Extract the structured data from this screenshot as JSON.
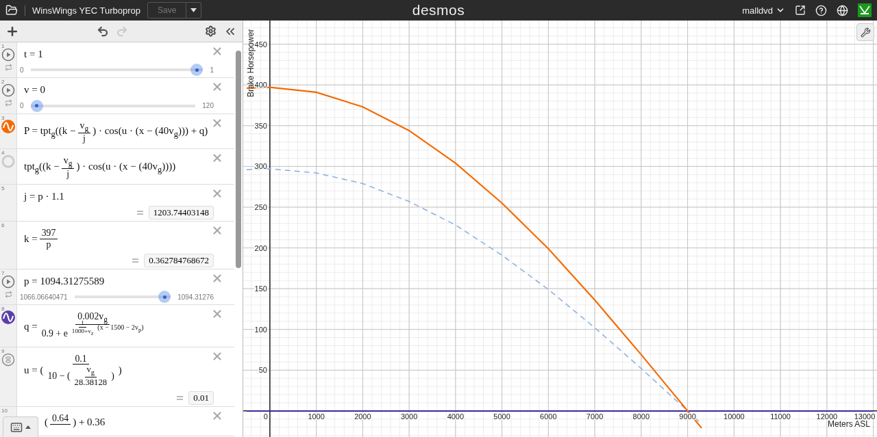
{
  "header": {
    "title": "WinsWings YEC Turboprop",
    "save_label": "Save",
    "logo": "desmos",
    "user": "malldvd"
  },
  "expressions": [
    {
      "kind": "slider",
      "number": "1",
      "expr": [
        "t = 1"
      ],
      "min": "0",
      "max": "1",
      "level": 1
    },
    {
      "kind": "slider",
      "number": "2",
      "expr": [
        "v = 0"
      ],
      "min": "0",
      "max": "120",
      "level": 0
    },
    {
      "kind": "graphed",
      "number": "3",
      "color": "#f56a00",
      "expr": [
        "P = tpt$_{g}$((k − ",
        {
          "num": [
            "v$_{g}$"
          ],
          "den": [
            "j"
          ]
        },
        ") · cos(u · (x − (40v$_{g}$))) + q)"
      ]
    },
    {
      "kind": "hidden",
      "number": "4",
      "expr": [
        "tpt$_{g}$((k − ",
        {
          "num": [
            "v$_{g}$"
          ],
          "den": [
            "j"
          ]
        },
        ") · cos(u · (x − (40v$_{g}$))))"
      ]
    },
    {
      "kind": "plain",
      "number": "5",
      "expr": [
        "j = p · 1.1"
      ],
      "output": "1203.74403148"
    },
    {
      "kind": "plain",
      "number": "6",
      "expr": [
        "k = ",
        {
          "num": [
            "397"
          ],
          "den": [
            "p"
          ]
        }
      ],
      "output": "0.362784768672"
    },
    {
      "kind": "slider",
      "number": "7",
      "expr": [
        "p = 1094.31275589"
      ],
      "min": "1066.06640471",
      "max": "1094.31276",
      "level": 1
    },
    {
      "kind": "graphed",
      "number": "8",
      "color": "#5b3fa8",
      "expr": [
        "q = ",
        {
          "num": [
            "0.002v$_{g}$"
          ],
          "den": [
            "0.9 + e",
            {
              "sup": [
                {
                  "num": [
                    "1"
                  ],
                  "den": [
                    "1000+v$_{z}$"
                  ]
                },
                "(x − 1500 − 2v$_{p}$)"
              ]
            }
          ]
        }
      ]
    },
    {
      "kind": "list",
      "number": "9",
      "expr": [
        "u = (",
        {
          "num": [
            "0.1"
          ],
          "den": [
            "10 − (",
            {
              "num": [
                "v$_{g}$"
              ],
              "den": [
                "28.38128"
              ]
            },
            ")"
          ]
        },
        ")"
      ],
      "output": "0.01"
    },
    {
      "kind": "plain",
      "number": "10",
      "expr": [
        "(",
        {
          "num": [
            "0.64"
          ]
        },
        ") + 0.36"
      ]
    }
  ],
  "graph": {
    "chart_data": {
      "type": "line",
      "xlabel": "Meters ASL",
      "ylabel": "Brake Horsepower",
      "grid": true,
      "x": [
        -500,
        0,
        1000,
        2000,
        3000,
        4000,
        5000,
        6000,
        7000,
        8000,
        9000,
        9300,
        10000,
        11000,
        12000,
        13000
      ],
      "series": [
        {
          "color": "#f56a00",
          "line_style": "solid",
          "values": [
            396,
            397,
            391,
            373,
            344,
            304,
            255,
            199,
            136,
            69,
            0,
            -21,
            null,
            null,
            null,
            null
          ]
        },
        {
          "color": "#8fb3df",
          "line_style": "dashed",
          "values": [
            296,
            297,
            292,
            279,
            257,
            228,
            191,
            149,
            102,
            52,
            0,
            -16,
            null,
            null,
            null,
            null
          ]
        },
        {
          "color": "#3b2a9b",
          "line_style": "solid",
          "values": [
            0,
            0,
            0,
            0,
            0,
            0,
            0,
            0,
            0,
            0,
            0,
            0,
            0,
            0,
            0,
            0
          ]
        }
      ],
      "xlim": [
        -574,
        13080
      ],
      "ylim": [
        -32,
        479
      ],
      "xticks": [
        0,
        1000,
        2000,
        3000,
        4000,
        5000,
        6000,
        7000,
        8000,
        9000,
        10000,
        11000,
        12000,
        13000
      ],
      "yticks": [
        50,
        100,
        150,
        200,
        250,
        300,
        350,
        400,
        450
      ]
    }
  }
}
